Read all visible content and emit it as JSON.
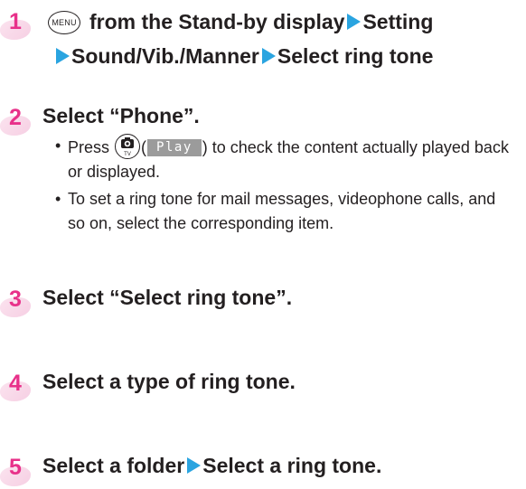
{
  "steps": [
    {
      "number": "1",
      "menu_key": "MENU",
      "line1_parts": [
        "from the Stand-by display",
        "Setting"
      ],
      "line2_parts": [
        "Sound/Vib./Manner",
        "Select ring tone"
      ]
    },
    {
      "number": "2",
      "title": "Select “Phone”.",
      "bullets": [
        {
          "press_label": "Press",
          "soft_key_label": "Play",
          "text_after": ") to check the content actually played back or displayed."
        },
        {
          "text": "To set a ring tone for mail messages, videophone calls, and so on, select the corresponding item."
        }
      ]
    },
    {
      "number": "3",
      "title": "Select “Select ring tone”."
    },
    {
      "number": "4",
      "title": "Select a type of ring tone."
    },
    {
      "number": "5",
      "title_parts": [
        "Select a folder",
        "Select a ring tone."
      ]
    }
  ],
  "colors": {
    "step_number": "#e8318a",
    "arrow": "#2aa4e0",
    "soft_key_bg": "#9b9b9b",
    "text": "#231f20"
  },
  "icons": {
    "menu": "menu-key-icon",
    "arrow": "arrow-right-icon",
    "camera": "camera-tv-key-icon"
  }
}
